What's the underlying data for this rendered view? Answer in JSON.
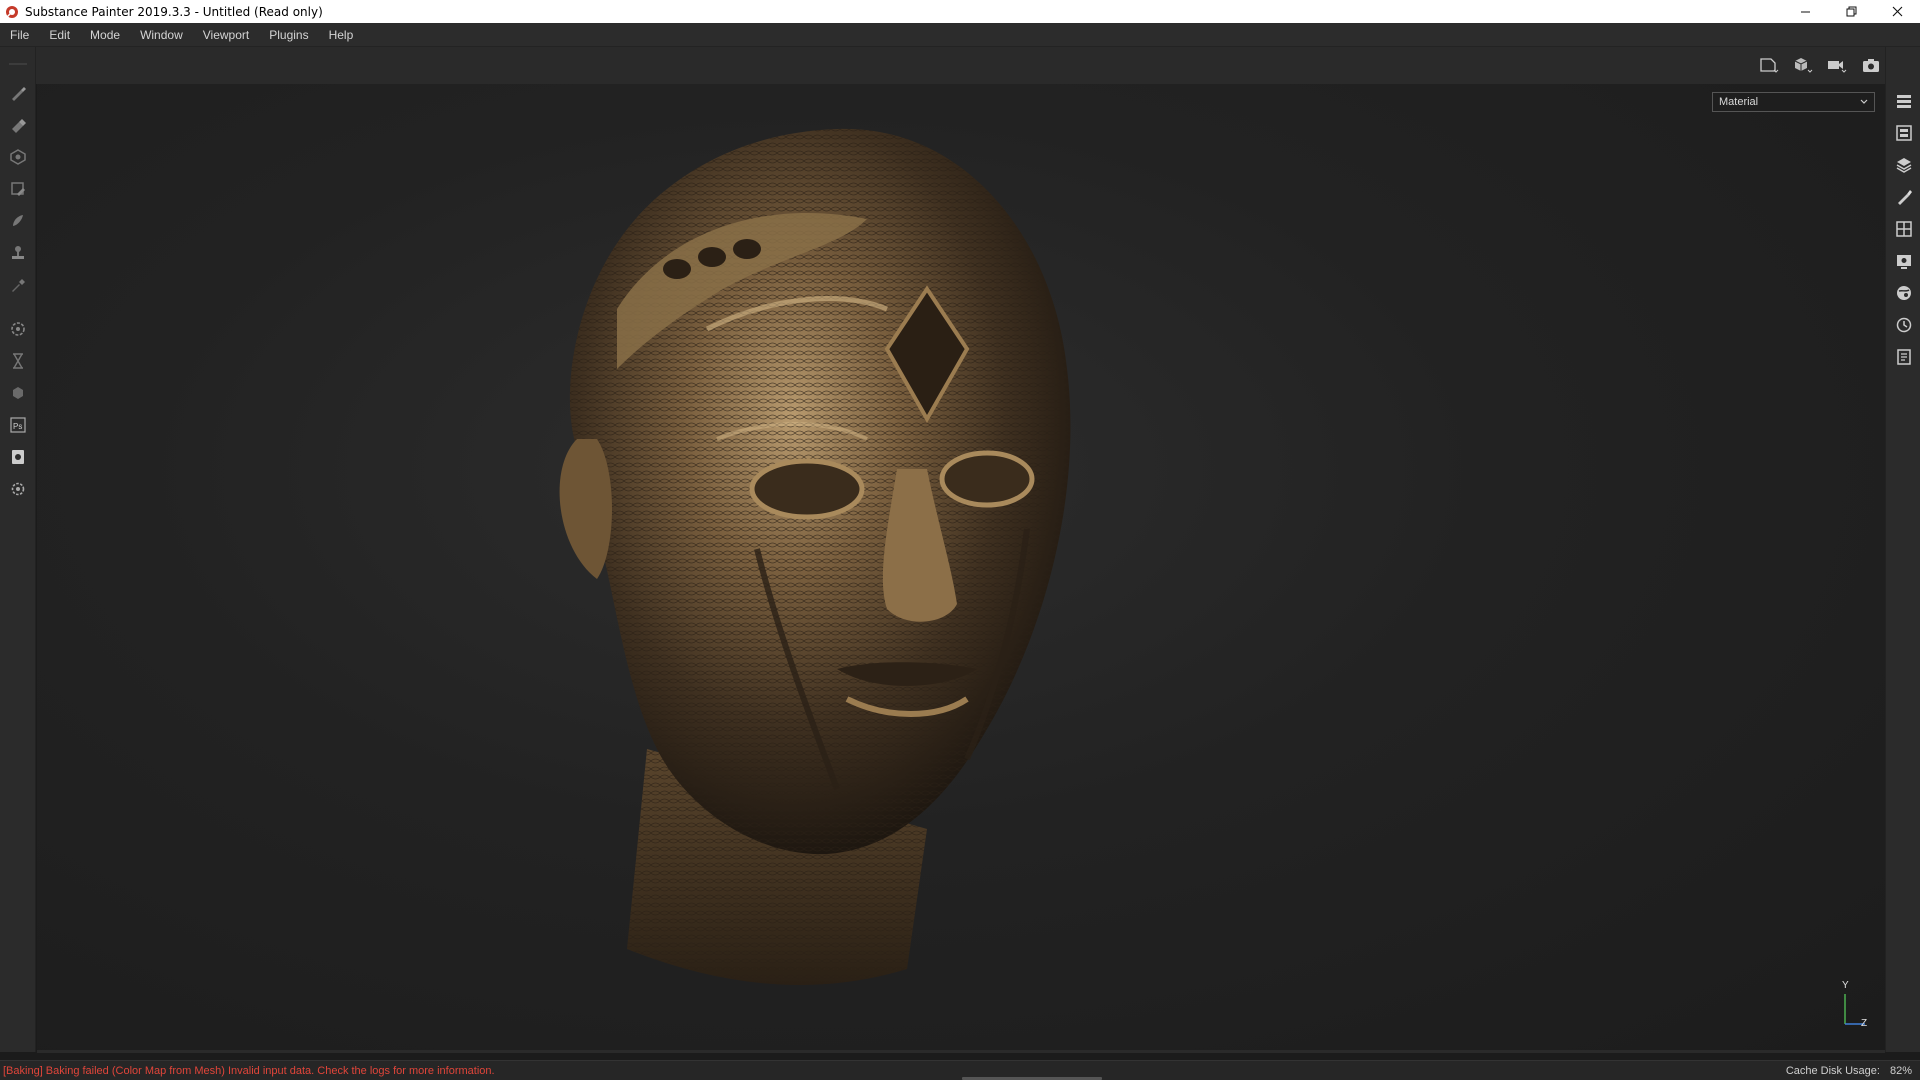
{
  "window": {
    "title": "Substance Painter 2019.3.3 - Untitled (Read only)"
  },
  "menu": {
    "items": [
      "File",
      "Edit",
      "Mode",
      "Window",
      "Viewport",
      "Plugins",
      "Help"
    ]
  },
  "left_toolbar": {
    "icons": [
      "paint-brush-icon",
      "eraser-icon",
      "projection-icon",
      "polygon-fill-icon",
      "smudge-icon",
      "clone-stamp-icon",
      "color-picker-icon",
      "bake-settings-icon",
      "hourglass-icon",
      "material-ball-icon",
      "photoshop-export-icon",
      "export-textures-icon",
      "settings-icon"
    ],
    "ps_label": "Ps"
  },
  "right_toolbar": {
    "icons": [
      "texture-set-list-icon",
      "texture-set-settings-icon",
      "layers-icon",
      "properties-icon",
      "display-settings-icon",
      "viewer-settings-icon",
      "shelf-icon",
      "history-icon",
      "log-icon"
    ]
  },
  "viewport_toolbar": {
    "icons": [
      "2d-view-icon",
      "3d-view-icon",
      "camera-icon",
      "screenshot-icon"
    ]
  },
  "viewport": {
    "channel_select": "Material",
    "axis": {
      "y": "Y",
      "z": "Z"
    }
  },
  "status": {
    "message": "[Baking] Baking failed (Color Map from Mesh) Invalid input data. Check the logs for more information.",
    "cache_label": "Cache Disk Usage:",
    "cache_value": "82%"
  },
  "colors": {
    "error": "#e0453a",
    "panel": "#2b2b2b",
    "viewport_bg": "#222222"
  }
}
